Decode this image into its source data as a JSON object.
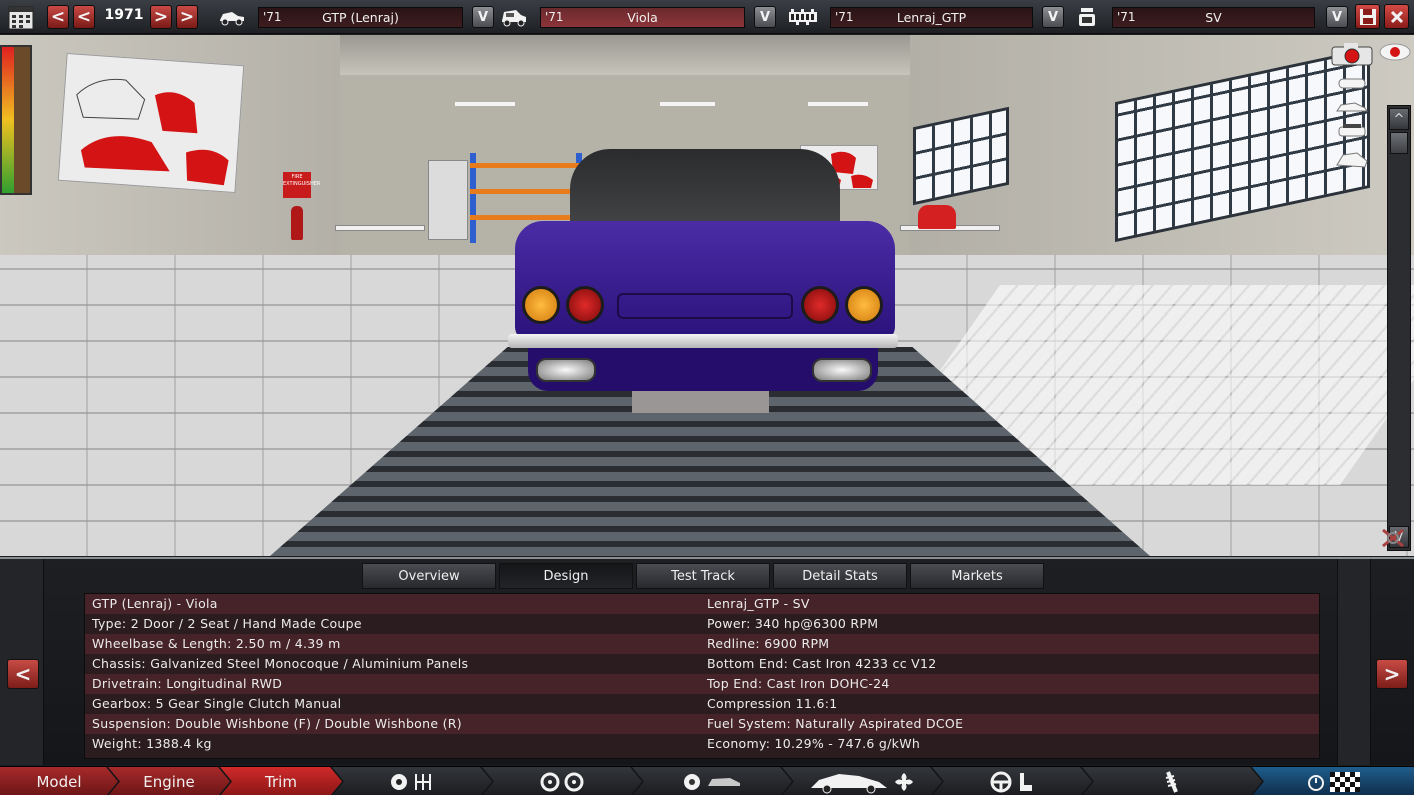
{
  "top_bar": {
    "year": "1971",
    "prev_labels": [
      "<",
      "<"
    ],
    "next_labels": [
      ">",
      ">"
    ],
    "selectors": [
      {
        "year": "'71",
        "name": "GTP (Lenraj)",
        "dropdown": "V",
        "icon": "car-model-icon"
      },
      {
        "year": "'71",
        "name": "Viola",
        "dropdown": "V",
        "icon": "car-trim-icon"
      },
      {
        "year": "'71",
        "name": "Lenraj_GTP",
        "dropdown": "V",
        "icon": "engine-family-icon"
      },
      {
        "year": "'71",
        "name": "SV",
        "dropdown": "V",
        "icon": "engine-variant-icon"
      }
    ]
  },
  "scene": {
    "sign_text": "FIRE EXTINGUISHER"
  },
  "camera_panel": {
    "scroll_up": "^",
    "scroll_down": "V"
  },
  "tabs": [
    "Overview",
    "Design",
    "Test Track",
    "Detail Stats",
    "Markets"
  ],
  "active_tab": "Design",
  "side_nav": {
    "left": "<",
    "right": ">"
  },
  "stats_left": [
    "GTP (Lenraj) - Viola",
    "Type: 2 Door / 2 Seat / Hand Made Coupe",
    "Wheelbase & Length: 2.50 m / 4.39 m",
    "Chassis: Galvanized Steel Monocoque / Aluminium Panels",
    "Drivetrain: Longitudinal RWD",
    "Gearbox: 5 Gear Single Clutch Manual",
    "Suspension: Double Wishbone (F) / Double Wishbone (R)",
    "Weight: 1388.4 kg"
  ],
  "stats_right": [
    "Lenraj_GTP - SV",
    "Power: 340 hp@6300 RPM",
    "Redline: 6900 RPM",
    "Bottom End: Cast Iron 4233 cc V12",
    "Top End: Cast Iron DOHC-24",
    "Compression 11.6:1",
    "Fuel System: Naturally Aspirated DCOE",
    "Economy: 10.29% - 747.6 g/kWh"
  ],
  "bottom_nav": {
    "model": "Model",
    "engine": "Engine",
    "trim": "Trim"
  },
  "colors": {
    "accent_red": "#a72a2a",
    "body_paint": "#3a1e96",
    "stats_bg": "#2a1c1f"
  }
}
